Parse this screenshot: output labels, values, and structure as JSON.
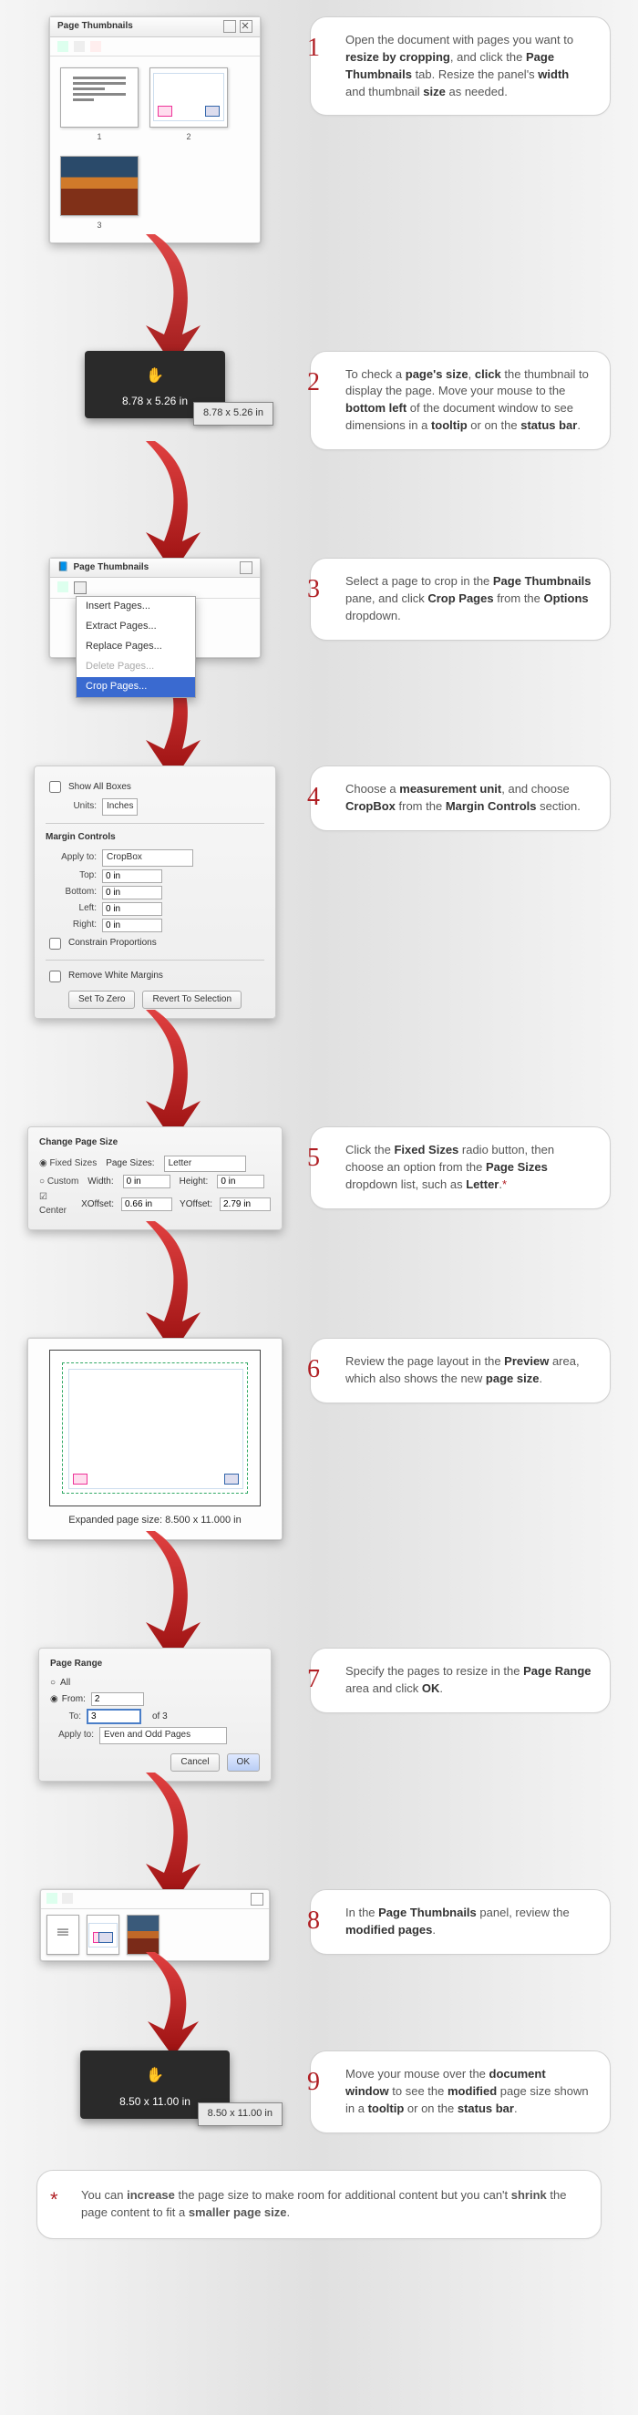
{
  "steps": [
    {
      "num": "1",
      "text_a": "Open the document with pages you want to ",
      "b1": "resize by cropping",
      "t2": ", and click the ",
      "b2": "Page Thumbnails",
      "t3": " tab. Resize the panel's ",
      "b3": "width",
      "t4": " and thumbnail ",
      "b4": "size",
      "t5": " as needed."
    },
    {
      "num": "2",
      "text_a": "To check a ",
      "b1": "page's size",
      "t2": ", ",
      "b2": "click",
      "t3": " the thumbnail to display the page. Move your mouse to the ",
      "b3": "bottom left",
      "t4": " of the document window to see dimensions in a ",
      "b4": "tooltip",
      "t5": " or on the ",
      "b5": "status bar",
      "t6": "."
    },
    {
      "num": "3",
      "text_a": "Select a page to crop in the ",
      "b1": "Page Thumbnails",
      "t2": " pane, and click ",
      "b2": "Crop Pages",
      "t3": " from the ",
      "b3": "Options",
      "t4": " dropdown."
    },
    {
      "num": "4",
      "text_a": "Choose a ",
      "b1": "measurement unit",
      "t2": ", and choose ",
      "b2": "CropBox",
      "t3": " from the ",
      "b3": "Margin Controls",
      "t4": " section."
    },
    {
      "num": "5",
      "text_a": "Click the ",
      "b1": "Fixed Sizes",
      "t2": " radio button, then choose an option from the ",
      "b2": "Page Sizes",
      "t3": " dropdown list, such as ",
      "b3": "Letter",
      "t4": "."
    },
    {
      "num": "6",
      "text_a": " Review the page layout in the ",
      "b1": "Preview",
      "t2": " area, which also shows the new ",
      "b2": "page size",
      "t3": "."
    },
    {
      "num": "7",
      "text_a": "Specify the pages to resize in the ",
      "b1": "Page Range",
      "t2": " area and click ",
      "b2": "OK",
      "t3": "."
    },
    {
      "num": "8",
      "text_a": "In the ",
      "b1": "Page Thumbnails",
      "t2": " panel, review the ",
      "b2": "modified pages",
      "t3": "."
    },
    {
      "num": "9",
      "text_a": "Move your mouse over the ",
      "b1": "document window",
      "t2": " to see the ",
      "b2": "modified",
      "t3": " page size shown in a ",
      "b3": "tooltip",
      "t4": " or on the ",
      "b4": "status bar",
      "t5": "."
    }
  ],
  "panel1": {
    "title": "Page Thumbnails",
    "thumb_labels": [
      "1",
      "2",
      "3"
    ]
  },
  "tooltip2": {
    "size": "8.78 x 5.26 in",
    "status": "8.78 x 5.26 in"
  },
  "panel3": {
    "title": "Page Thumbnails",
    "menu": [
      "Insert Pages...",
      "Extract Pages...",
      "Replace Pages...",
      "Delete Pages...",
      "Crop Pages..."
    ]
  },
  "dialog4": {
    "show_all": "Show All Boxes",
    "units_label": "Units:",
    "units_value": "Inches",
    "margin_hdr": "Margin Controls",
    "apply_label": "Apply to:",
    "apply_value": "CropBox",
    "top": "Top:",
    "bottom": "Bottom:",
    "left": "Left:",
    "right": "Right:",
    "val": "0 in",
    "constrain": "Constrain Proportions",
    "remove_white": "Remove White Margins",
    "set_zero": "Set To Zero",
    "revert": "Revert To Selection"
  },
  "dialog5": {
    "hdr": "Change Page Size",
    "fixed": "Fixed Sizes",
    "page_sizes_label": "Page Sizes:",
    "page_sizes_value": "Letter",
    "custom": "Custom",
    "width_label": "Width:",
    "height_label": "Height:",
    "wh_val": "0 in",
    "center": "Center",
    "xoff": "XOffset:",
    "xoff_val": "0.66 in",
    "yoff": "YOffset:",
    "yoff_val": "2.79 in"
  },
  "preview6": {
    "caption_lead": "Expanded page size: ",
    "caption_val": "8.500 x 11.000 in"
  },
  "dialog7": {
    "hdr": "Page Range",
    "all": "All",
    "from": "From:",
    "from_val": "2",
    "to": "To:",
    "to_val": "3",
    "of": "of 3",
    "apply": "Apply to:",
    "apply_val": "Even and Odd Pages",
    "cancel": "Cancel",
    "ok": "OK"
  },
  "tooltip9": {
    "size": "8.50 x 11.00 in",
    "status": "8.50 x 11.00 in"
  },
  "footnote": {
    "lead": "You can ",
    "b1": "increase",
    "t2": " the page size to make room for additional content but you can't ",
    "b2": "shrink",
    "t3": " the page content to fit a ",
    "b3": "smaller page size",
    "t4": "."
  },
  "ast": "*"
}
